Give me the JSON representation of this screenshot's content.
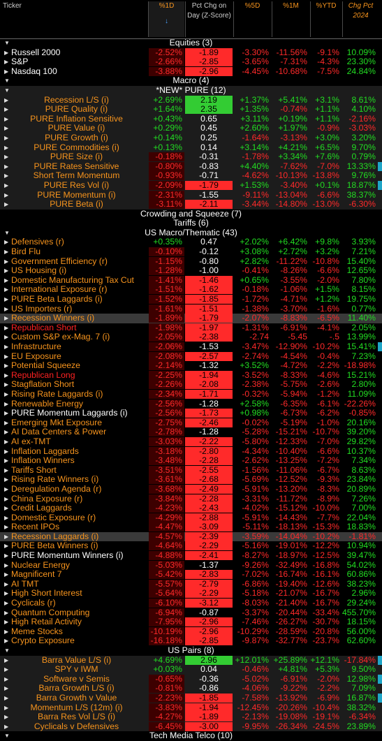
{
  "headers": [
    {
      "id": "ticker",
      "text": "Ticker",
      "sort": ""
    },
    {
      "id": "d1",
      "text": "%1D",
      "sort": "↓"
    },
    {
      "id": "z",
      "text": "Pct Chg on Day (Z-Score)",
      "sort": ""
    },
    {
      "id": "d5",
      "text": "%5D",
      "sort": ""
    },
    {
      "id": "m1",
      "text": "%1M",
      "sort": ""
    },
    {
      "id": "ytd",
      "text": "%YTD",
      "sort": ""
    },
    {
      "id": "c24",
      "text": "Chg Pct 2024",
      "sort": ""
    }
  ],
  "colors": {
    "positive": "#22dd22",
    "negative": "#ff2a2a",
    "ticker": "#f7941d",
    "z_red": "#ff2a2a",
    "z_green": "#33cc33",
    "marker": "#1fa6c8"
  },
  "rows": [
    {
      "kind": "section",
      "label": "Equities (3)"
    },
    {
      "kind": "data",
      "name": "Russell 2000",
      "white": true,
      "v": [
        "-2.52%",
        "-1.89",
        "-3.30%",
        "-11.56%",
        "-9.1%",
        "10.09%"
      ],
      "z": "red"
    },
    {
      "kind": "data",
      "name": "S&P",
      "white": true,
      "v": [
        "-2.66%",
        "-2.85",
        "-3.65%",
        "-7.31%",
        "-4.3%",
        "23.30%"
      ],
      "z": "red"
    },
    {
      "kind": "data",
      "name": "Nasdaq 100",
      "white": true,
      "v": [
        "-3.88%",
        "-2.96",
        "-4.45%",
        "-10.68%",
        "-7.5%",
        "24.84%"
      ],
      "z": "red"
    },
    {
      "kind": "section",
      "label": "Macro (4)"
    },
    {
      "kind": "section",
      "label": "*NEW* PURE (12)",
      "band": true
    },
    {
      "kind": "data",
      "name": "Recession L/S (i)",
      "center": true,
      "v": [
        "+2.69%",
        "2.19",
        "+1.37%",
        "+5.41%",
        "+3.1%",
        "8.61%"
      ],
      "z": "green"
    },
    {
      "kind": "data",
      "name": "PURE Quality (i)",
      "center": true,
      "v": [
        "+1.64%",
        "2.35",
        "+1.35%",
        "-0.74%",
        "+1.1%",
        "4.10%"
      ],
      "z": "green"
    },
    {
      "kind": "data",
      "name": "PURE Inflation Sensitive",
      "center": true,
      "v": [
        "+0.43%",
        "0.65",
        "+3.11%",
        "+0.19%",
        "+1.1%",
        "-2.16%"
      ]
    },
    {
      "kind": "data",
      "name": "PURE Value (i)",
      "center": true,
      "v": [
        "+0.29%",
        "0.45",
        "+2.60%",
        "+1.97%",
        "-0.9%",
        "-3.03%"
      ]
    },
    {
      "kind": "data",
      "name": "PURE Growth (i)",
      "center": true,
      "v": [
        "+0.14%",
        "0.25",
        "-1.64%",
        "-3.13%",
        "+3.0%",
        "3.20%"
      ]
    },
    {
      "kind": "data",
      "name": "PURE Commodities (i)",
      "center": true,
      "v": [
        "+0.13%",
        "0.14",
        "+3.14%",
        "+4.21%",
        "+6.5%",
        "9.70%"
      ]
    },
    {
      "kind": "data",
      "name": "PURE Size (i)",
      "center": true,
      "v": [
        "-0.18%",
        "-0.31",
        "-1.78%",
        "+3.34%",
        "+7.6%",
        "0.79%"
      ]
    },
    {
      "kind": "data",
      "name": "PURE Rates Sensitive",
      "center": true,
      "v": [
        "-0.80%",
        "-0.83",
        "+4.40%",
        "-7.62%",
        "-7.0%",
        "13.33%"
      ],
      "mk": true
    },
    {
      "kind": "data",
      "name": "Short Term Momentum",
      "center": true,
      "v": [
        "-0.93%",
        "-0.71",
        "-4.62%",
        "-10.13%",
        "-13.8%",
        "9.76%"
      ]
    },
    {
      "kind": "data",
      "name": "PURE Res Vol (i)",
      "center": true,
      "v": [
        "-2.09%",
        "-1.79",
        "+1.53%",
        "-3.40%",
        "+0.1%",
        "18.87%"
      ],
      "z": "red",
      "mk": true
    },
    {
      "kind": "data",
      "name": "PURE Momentum (i)",
      "center": true,
      "v": [
        "-2.31%",
        "-1.55",
        "-9.11%",
        "-13.04%",
        "-6.6%",
        "38.37%"
      ]
    },
    {
      "kind": "data",
      "name": "PURE Beta (i)",
      "center": true,
      "v": [
        "-3.11%",
        "-2.11",
        "-3.44%",
        "-14.80%",
        "-13.0%",
        "-6.30%"
      ],
      "z": "red"
    },
    {
      "kind": "section",
      "label": "Crowding and Squeeze (7)",
      "noarrow": true
    },
    {
      "kind": "section",
      "label": "Tariffs (6)",
      "noarrow": true
    },
    {
      "kind": "section",
      "label": "US Macro/Thematic (43)"
    },
    {
      "kind": "data",
      "name": "Defensives (r)",
      "v": [
        "+0.35%",
        "0.47",
        "+2.02%",
        "+6.42%",
        "+9.8%",
        "3.93%"
      ]
    },
    {
      "kind": "data",
      "name": "Bird Flu",
      "v": [
        "-0.10%",
        "-0.12",
        "+3.08%",
        "+2.72%",
        "+3.2%",
        "7.21%"
      ]
    },
    {
      "kind": "data",
      "name": "Government Efficiency (r)",
      "v": [
        "-1.15%",
        "-0.80",
        "+2.82%",
        "-11.22%",
        "-10.8%",
        "15.40%"
      ]
    },
    {
      "kind": "data",
      "name": "US Housing (i)",
      "v": [
        "-1.28%",
        "-1.00",
        "-0.41%",
        "-8.26%",
        "-6.6%",
        "12.65%"
      ]
    },
    {
      "kind": "data",
      "name": "Domestic Manufacturing Tax Cut",
      "v": [
        "-1.41%",
        "-1.46",
        "+0.65%",
        "-3.55%",
        "-2.0%",
        "7.80%"
      ],
      "z": "red"
    },
    {
      "kind": "data",
      "name": "International Exposure (r)",
      "v": [
        "-1.51%",
        "-1.62",
        "-0.18%",
        "-1.06%",
        "+1.5%",
        "8.15%"
      ],
      "z": "red"
    },
    {
      "kind": "data",
      "name": "PURE Beta Laggards (i)",
      "v": [
        "-1.52%",
        "-1.85",
        "-1.72%",
        "-4.71%",
        "+1.2%",
        "19.75%"
      ],
      "z": "red"
    },
    {
      "kind": "data",
      "name": "US Importers (r)",
      "v": [
        "-1.61%",
        "-1.51",
        "-1.38%",
        "-3.70%",
        "-1.6%",
        "0.77%"
      ],
      "z": "red"
    },
    {
      "kind": "data",
      "name": "Recession Winners (i)",
      "v": [
        "-1.89%",
        "-1.79",
        "-2.07%",
        "-8.83%",
        "-6.5%",
        "11.40%"
      ],
      "z": "red",
      "hl": true
    },
    {
      "kind": "data",
      "name": "Republican Short",
      "red": true,
      "v": [
        "-1.98%",
        "-1.97",
        "-1.31%",
        "-6.91%",
        "-4.1%",
        "2.05%"
      ],
      "z": "red"
    },
    {
      "kind": "data",
      "name": "Custom S&P ex-Mag. 7 (i)",
      "v": [
        "-2.05%",
        "-2.38",
        "-2.74",
        "-5.45",
        "-.5",
        "13.99%"
      ],
      "z": "red"
    },
    {
      "kind": "data",
      "name": "Infrastructure",
      "v": [
        "-2.06%",
        "-1.53",
        "-3.47%",
        "-12.90%",
        "-10.2%",
        "15.41%"
      ],
      "mk": true
    },
    {
      "kind": "data",
      "name": "EU Exposure",
      "v": [
        "-2.08%",
        "-2.57",
        "-2.74%",
        "-4.54%",
        "-0.4%",
        "7.23%"
      ],
      "z": "red"
    },
    {
      "kind": "data",
      "name": "Potential Squeeze",
      "v": [
        "-2.14%",
        "-1.32",
        "+3.52%",
        "-4.72%",
        "-2.2%",
        "-18.98%"
      ]
    },
    {
      "kind": "data",
      "name": "Republican Long",
      "red": true,
      "v": [
        "-2.25%",
        "-1.94",
        "-3.52%",
        "-8.33%",
        "-4.6%",
        "15.21%"
      ],
      "z": "red"
    },
    {
      "kind": "data",
      "name": "Stagflation Short",
      "v": [
        "-2.26%",
        "-2.08",
        "-2.38%",
        "-5.75%",
        "-2.6%",
        "2.80%"
      ],
      "z": "red"
    },
    {
      "kind": "data",
      "name": "Rising Rate Laggards (i)",
      "v": [
        "-2.34%",
        "-1.71",
        "-0.32%",
        "-5.94%",
        "-1.2%",
        "11.09%"
      ],
      "z": "red"
    },
    {
      "kind": "data",
      "name": "Renewable Energy",
      "v": [
        "-2.56%",
        "-1.28",
        "+2.58%",
        "-6.35%",
        "-6.1%",
        "-22.26%"
      ]
    },
    {
      "kind": "data",
      "name": "PURE Momentum Laggards (i)",
      "white": true,
      "v": [
        "-2.56%",
        "-1.73",
        "+0.98%",
        "-6.73%",
        "-6.2%",
        "-0.85%"
      ],
      "z": "red"
    },
    {
      "kind": "data",
      "name": "Emerging Mkt Exposure",
      "v": [
        "-2.75%",
        "-2.46",
        "-0.02%",
        "-5.19%",
        "-1.0%",
        "20.16%"
      ],
      "z": "red"
    },
    {
      "kind": "data",
      "name": "AI Data Centers & Power",
      "v": [
        "-2.78%",
        "-1.28",
        "-5.28%",
        "-15.21%",
        "-10.7%",
        "39.20%"
      ]
    },
    {
      "kind": "data",
      "name": "AI ex-TMT",
      "v": [
        "-3.03%",
        "-2.22",
        "-5.80%",
        "-12.33%",
        "-7.0%",
        "29.82%"
      ],
      "z": "red"
    },
    {
      "kind": "data",
      "name": "Inflation Laggards",
      "v": [
        "-3.18%",
        "-2.80",
        "-4.34%",
        "-10.40%",
        "-6.6%",
        "10.37%"
      ],
      "z": "red"
    },
    {
      "kind": "data",
      "name": "Inflation Winners",
      "v": [
        "-3.48%",
        "-2.28",
        "-2.62%",
        "-13.25%",
        "-7.2%",
        "7.34%"
      ],
      "z": "red"
    },
    {
      "kind": "data",
      "name": "Tariffs Short",
      "v": [
        "-3.51%",
        "-2.55",
        "-1.56%",
        "-11.06%",
        "-6.7%",
        "8.63%"
      ],
      "z": "red"
    },
    {
      "kind": "data",
      "name": "Rising Rate Winners (i)",
      "v": [
        "-3.61%",
        "-2.68",
        "-5.69%",
        "-12.52%",
        "-9.3%",
        "23.84%"
      ],
      "z": "red"
    },
    {
      "kind": "data",
      "name": "Deregulation Agenda (r)",
      "v": [
        "-3.68%",
        "-2.49",
        "-5.91%",
        "-13.20%",
        "-8.3%",
        "20.89%"
      ],
      "z": "red"
    },
    {
      "kind": "data",
      "name": "China Exposure (r)",
      "v": [
        "-3.84%",
        "-2.28",
        "-3.31%",
        "-11.72%",
        "-8.9%",
        "7.26%"
      ],
      "z": "red"
    },
    {
      "kind": "data",
      "name": "Credit Laggards",
      "v": [
        "-4.23%",
        "-2.43",
        "-4.02%",
        "-15.12%",
        "-10.0%",
        "7.00%"
      ],
      "z": "red"
    },
    {
      "kind": "data",
      "name": "Domestic Exposure (r)",
      "v": [
        "-4.29%",
        "-2.88",
        "-5.91%",
        "-14.43%",
        "-7.7%",
        "22.04%"
      ],
      "z": "red"
    },
    {
      "kind": "data",
      "name": "Recent IPOs",
      "v": [
        "-4.47%",
        "-3.09",
        "-5.11%",
        "-18.13%",
        "-15.3%",
        "18.83%"
      ],
      "z": "red"
    },
    {
      "kind": "data",
      "name": "Recession Laggards (i)",
      "v": [
        "-4.57%",
        "-2.39",
        "-3.59%",
        "-14.04%",
        "-10.2%",
        "-1.81%"
      ],
      "z": "red",
      "hl": true
    },
    {
      "kind": "data",
      "name": "PURE Beta Winners (i)",
      "v": [
        "-4.64%",
        "-2.29",
        "-5.16%",
        "-19.01%",
        "-12.2%",
        "10.94%"
      ],
      "z": "red"
    },
    {
      "kind": "data",
      "name": "PURE Momentum Winners (i)",
      "white": true,
      "v": [
        "-4.88%",
        "-2.41",
        "-8.27%",
        "-18.97%",
        "-12.5%",
        "39.47%"
      ],
      "z": "red"
    },
    {
      "kind": "data",
      "name": "Nuclear Energy",
      "v": [
        "-5.03%",
        "-1.37",
        "-9.26%",
        "-32.49%",
        "-16.8%",
        "54.02%"
      ]
    },
    {
      "kind": "data",
      "name": "Magnificent 7",
      "v": [
        "-5.42%",
        "-2.83",
        "-7.02%",
        "-16.74%",
        "-16.1%",
        "60.86%"
      ],
      "z": "red"
    },
    {
      "kind": "data",
      "name": "AI TMT",
      "v": [
        "-5.57%",
        "-2.79",
        "-6.86%",
        "-19.40%",
        "-12.6%",
        "38.23%"
      ],
      "z": "red"
    },
    {
      "kind": "data",
      "name": "High Short Interest",
      "v": [
        "-5.64%",
        "-2.29",
        "-5.18%",
        "-21.07%",
        "-16.7%",
        "2.96%"
      ],
      "z": "red"
    },
    {
      "kind": "data",
      "name": "Cyclicals (r)",
      "v": [
        "-6.10%",
        "-3.12",
        "-8.03%",
        "-21.40%",
        "-16.7%",
        "29.24%"
      ],
      "z": "red"
    },
    {
      "kind": "data",
      "name": "Quantum Computing",
      "v": [
        "-6.94%",
        "-0.87",
        "-3.37%",
        "-20.44%",
        "-33.4%",
        "455.70%"
      ]
    },
    {
      "kind": "data",
      "name": "High Retail Activity",
      "v": [
        "-7.95%",
        "-2.96",
        "-7.46%",
        "-26.27%",
        "-30.7%",
        "18.15%"
      ],
      "z": "red"
    },
    {
      "kind": "data",
      "name": "Meme Stocks",
      "v": [
        "-10.19%",
        "-2.96",
        "-10.29%",
        "-28.59%",
        "-20.8%",
        "56.00%"
      ],
      "z": "red"
    },
    {
      "kind": "data",
      "name": "Crypto Exposure",
      "v": [
        "-16.18%",
        "-2.85",
        "-9.87%",
        "-32.77%",
        "-23.7%",
        "62.60%"
      ],
      "z": "red"
    },
    {
      "kind": "section",
      "label": "US Pairs (8)"
    },
    {
      "kind": "data",
      "name": "Barra Value L/S (i)",
      "center": true,
      "v": [
        "+4.69%",
        "2.96",
        "+12.01%",
        "+25.89%",
        "+12.1%",
        "-17.84%"
      ],
      "z": "green",
      "mk": true
    },
    {
      "kind": "data",
      "name": "SPY v IWM",
      "center": true,
      "v": [
        "+0.03%",
        "0.04",
        "-0.46%",
        "+4.81%",
        "+5.3%",
        "9.50%"
      ]
    },
    {
      "kind": "data",
      "name": "Software v Semis",
      "center": true,
      "v": [
        "-0.65%",
        "-0.36",
        "-5.02%",
        "-6.91%",
        "-2.0%",
        "12.98%"
      ],
      "mk": true
    },
    {
      "kind": "data",
      "name": "Barra Growth L/S (i)",
      "center": true,
      "v": [
        "-0.81%",
        "-0.86",
        "-4.06%",
        "-9.22%",
        "-2.2%",
        "7.09%"
      ]
    },
    {
      "kind": "data",
      "name": "Barra Growth v Value",
      "center": true,
      "v": [
        "-2.23%",
        "-1.85",
        "-7.58%",
        "-13.92%",
        "-6.9%",
        "16.87%"
      ],
      "z": "red",
      "mk": true
    },
    {
      "kind": "data",
      "name": "Momentum L/S (12m) (i)",
      "center": true,
      "v": [
        "-3.83%",
        "-1.94",
        "-12.45%",
        "-20.26%",
        "-10.4%",
        "38.32%"
      ],
      "z": "red"
    },
    {
      "kind": "data",
      "name": "Barra Res Vol L/S (i)",
      "center": true,
      "v": [
        "-4.27%",
        "-1.89",
        "-2.13%",
        "-19.08%",
        "-19.1%",
        "-6.34%"
      ],
      "z": "red"
    },
    {
      "kind": "data",
      "name": "Cyclicals v Defensives",
      "center": true,
      "v": [
        "-6.45%",
        "-3.00",
        "-9.95%",
        "-26.34%",
        "-24.5%",
        "23.89%"
      ],
      "z": "red"
    },
    {
      "kind": "section",
      "label": "Tech Media Telco (10)",
      "cut": true
    }
  ]
}
